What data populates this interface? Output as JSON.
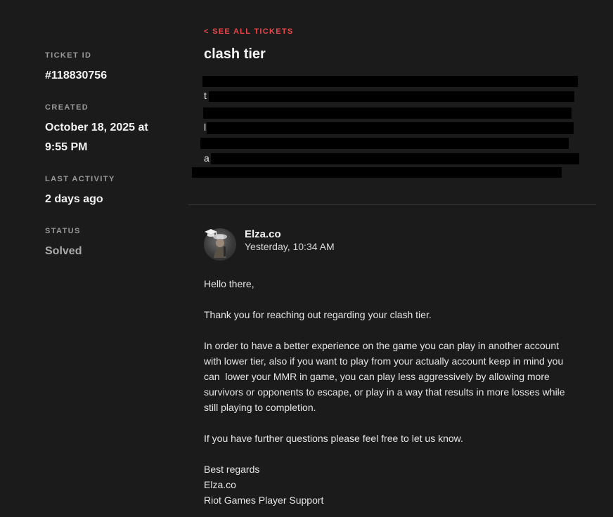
{
  "sidebar": {
    "ticket_id_label": "TICKET ID",
    "ticket_id": "#118830756",
    "created_label": "CREATED",
    "created_value": "October 18, 2025 at 9:55 PM",
    "last_activity_label": "LAST ACTIVITY",
    "last_activity_value": "2 days ago",
    "status_label": "STATUS",
    "status_value": "Solved"
  },
  "ticket": {
    "back_link": "< SEE ALL TICKETS",
    "title": "clash tier",
    "description_fragments": [
      "t",
      "l",
      "a"
    ]
  },
  "reply": {
    "author": "Elza.co",
    "timestamp": "Yesterday, 10:34 AM",
    "paragraphs": [
      [
        "Hello there,"
      ],
      [
        "Thank you for reaching out regarding your clash tier."
      ],
      [
        "In order to have a better experience on the game you can play in another account",
        "with lower tier, also if you want to play from your actually account keep in mind you",
        "can  lower your MMR in game, you can play less aggressively by allowing more",
        "survivors or opponents to escape, or play in a way that results in more losses while",
        "still playing to completion."
      ],
      [
        "If you have further questions please feel free to let us know."
      ],
      [
        "Best regards",
        "Elza.co",
        "Riot Games Player Support"
      ]
    ]
  },
  "colors": {
    "background": "#1b1b1c",
    "accent": "#e8484b",
    "muted_text": "#9a9a9a"
  }
}
